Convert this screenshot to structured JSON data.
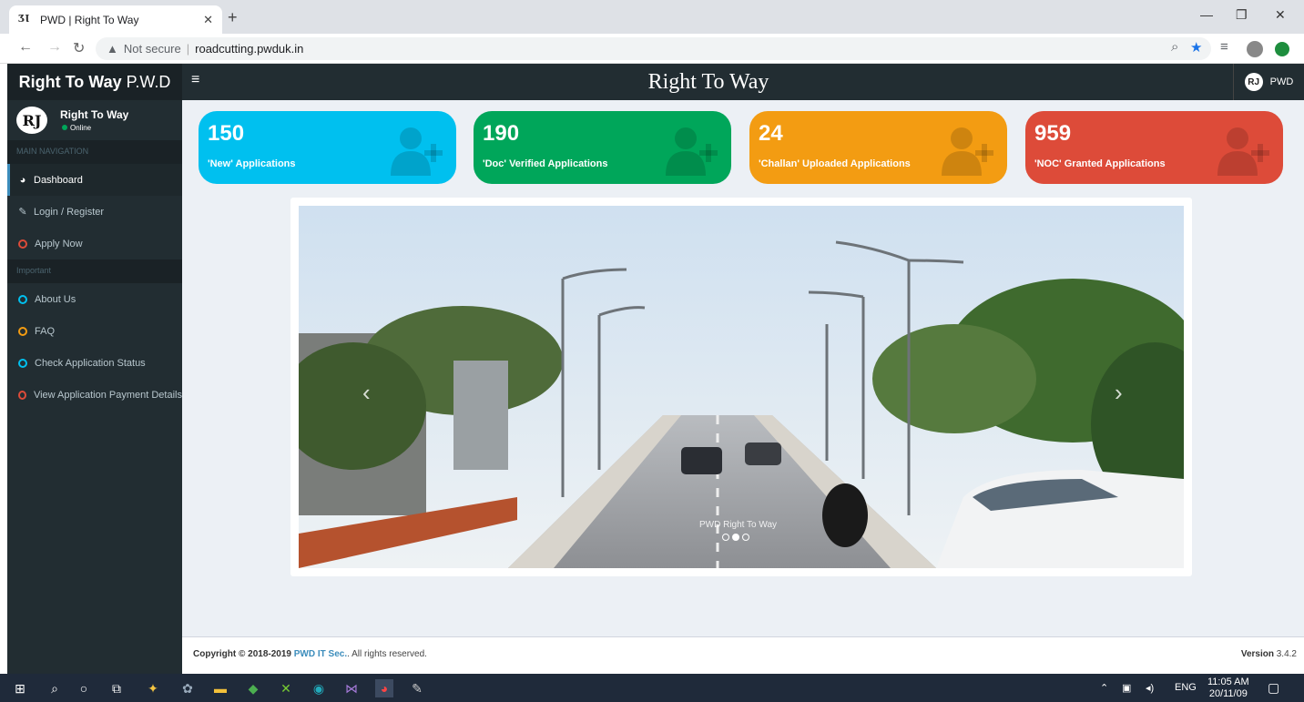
{
  "browser": {
    "tab_title": "PWD | Right To Way",
    "tab_favicon": "ƷƖ",
    "new_tab": "+",
    "security_label": "Not secure",
    "url": "roadcutting.pwduk.in"
  },
  "app": {
    "logo_bold": "Right To Way",
    "logo_rest": "P.W.D",
    "title": "Right To Way",
    "user_menu_label": "PWD",
    "user_logo": "RJ"
  },
  "sidebar": {
    "user_name": "Right To Way",
    "user_status": "Online",
    "main_header": "MAIN NAVIGATION",
    "important_header": "Important",
    "items": [
      {
        "label": "Dashboard"
      },
      {
        "label": "Login / Register"
      },
      {
        "label": "Apply Now"
      },
      {
        "label": "About Us"
      },
      {
        "label": "FAQ"
      },
      {
        "label": "Check Application Status"
      },
      {
        "label": "View Application Payment Details"
      }
    ]
  },
  "stats": [
    {
      "value": "150",
      "label": "'New' Applications",
      "color": "#00c0ef"
    },
    {
      "value": "190",
      "label": "'Doc' Verified Applications",
      "color": "#00a65a"
    },
    {
      "value": "24",
      "label": "'Challan' Uploaded Applications",
      "color": "#f39c12"
    },
    {
      "value": "959",
      "label": "'NOC' Granted Applications",
      "color": "#dd4b39"
    }
  ],
  "carousel": {
    "caption": "PWD Right To Way",
    "active_slide": 2,
    "slide_count": 3
  },
  "footer": {
    "copyright_prefix": "Copyright © 2018-2019",
    "company": "PWD IT Sec.",
    "suffix": ". All rights reserved.",
    "version_label": "Version",
    "version": "3.4.2"
  },
  "taskbar": {
    "language": "ENG",
    "time": "11:05 AM",
    "date": "20/11/09"
  },
  "colors": {
    "sidebar_bg": "#222d32",
    "content_bg": "#ecf0f5",
    "link": "#3c8dbc"
  }
}
